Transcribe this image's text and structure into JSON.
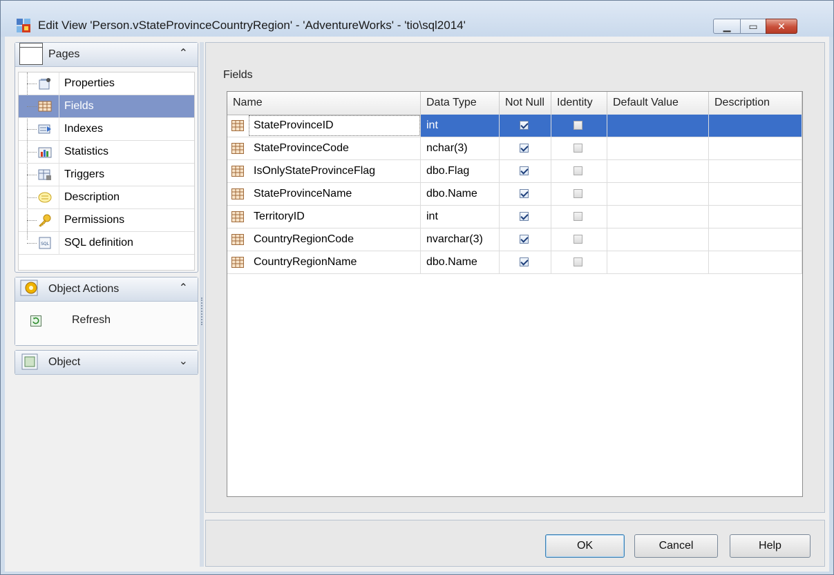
{
  "window": {
    "title": "Edit View 'Person.vStateProvinceCountryRegion' - 'AdventureWorks' - 'tio\\sql2014'"
  },
  "pages": {
    "header": "Pages",
    "items": [
      {
        "label": "Properties",
        "icon": "properties-icon",
        "selected": false
      },
      {
        "label": "Fields",
        "icon": "fields-icon",
        "selected": true
      },
      {
        "label": "Indexes",
        "icon": "indexes-icon",
        "selected": false
      },
      {
        "label": "Statistics",
        "icon": "statistics-icon",
        "selected": false
      },
      {
        "label": "Triggers",
        "icon": "triggers-icon",
        "selected": false
      },
      {
        "label": "Description",
        "icon": "description-icon",
        "selected": false
      },
      {
        "label": "Permissions",
        "icon": "permissions-icon",
        "selected": false
      },
      {
        "label": "SQL definition",
        "icon": "sql-definition-icon",
        "selected": false
      }
    ]
  },
  "object_actions": {
    "header": "Object Actions",
    "items": [
      {
        "label": "Refresh",
        "icon": "refresh-icon"
      }
    ]
  },
  "object_group": {
    "header": "Object"
  },
  "fields": {
    "label": "Fields",
    "columns": [
      "Name",
      "Data Type",
      "Not Null",
      "Identity",
      "Default Value",
      "Description"
    ],
    "rows": [
      {
        "name": "StateProvinceID",
        "type": "int",
        "not_null": true,
        "identity": false,
        "default": "",
        "description": ""
      },
      {
        "name": "StateProvinceCode",
        "type": "nchar(3)",
        "not_null": true,
        "identity": false,
        "default": "",
        "description": ""
      },
      {
        "name": "IsOnlyStateProvinceFlag",
        "type": "dbo.Flag",
        "not_null": true,
        "identity": false,
        "default": "",
        "description": ""
      },
      {
        "name": "StateProvinceName",
        "type": "dbo.Name",
        "not_null": true,
        "identity": false,
        "default": "",
        "description": ""
      },
      {
        "name": "TerritoryID",
        "type": "int",
        "not_null": true,
        "identity": false,
        "default": "",
        "description": ""
      },
      {
        "name": "CountryRegionCode",
        "type": "nvarchar(3)",
        "not_null": true,
        "identity": false,
        "default": "",
        "description": ""
      },
      {
        "name": "CountryRegionName",
        "type": "dbo.Name",
        "not_null": true,
        "identity": false,
        "default": "",
        "description": ""
      }
    ],
    "selected_row": 0
  },
  "buttons": {
    "ok": "OK",
    "cancel": "Cancel",
    "help": "Help"
  },
  "colors": {
    "selection": "#3a6fc9",
    "nav_selection": "#7f95c9",
    "close_button": "#c94f3a"
  }
}
